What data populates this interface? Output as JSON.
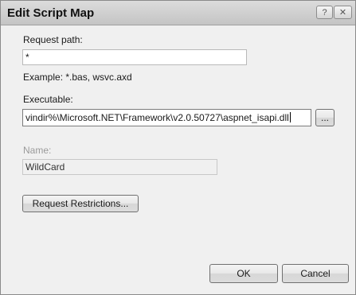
{
  "window": {
    "title": "Edit Script Map",
    "help_glyph": "?",
    "close_glyph": "✕"
  },
  "request_path": {
    "label": "Request path:",
    "value": "*",
    "example": "Example: *.bas, wsvc.axd"
  },
  "executable": {
    "label": "Executable:",
    "value": "vindir%\\Microsoft.NET\\Framework\\v2.0.50727\\aspnet_isapi.dll",
    "browse_label": "..."
  },
  "name": {
    "label": "Name:",
    "value": "WildCard"
  },
  "buttons": {
    "request_restrictions": "Request Restrictions...",
    "ok": "OK",
    "cancel": "Cancel"
  }
}
